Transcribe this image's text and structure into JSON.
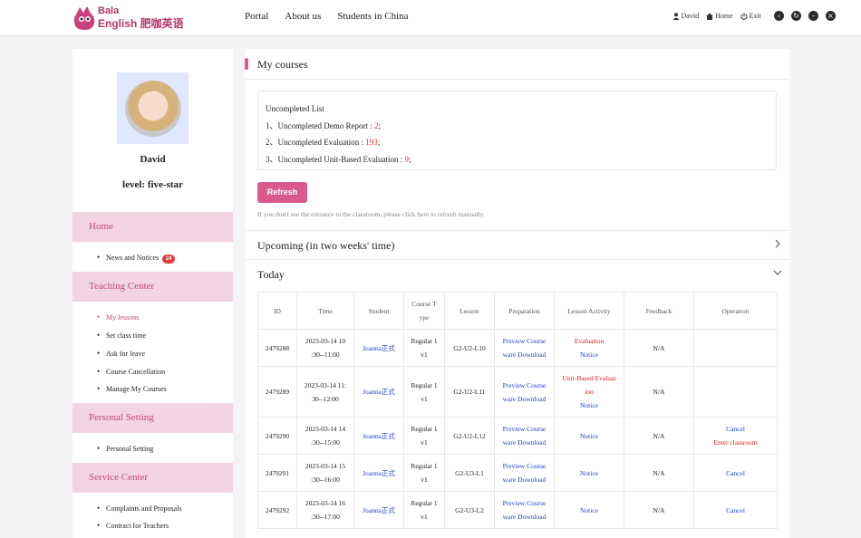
{
  "header": {
    "logo_line1": "Bala",
    "logo_line2": "English 肥咖英语",
    "nav": [
      "Portal",
      "About us",
      "Students in China"
    ],
    "user_name": "David",
    "home_label": "Home",
    "exit_label": "Exit"
  },
  "sidebar": {
    "username": "David",
    "level": "level: five-star",
    "sections": [
      {
        "label": "Home",
        "items": [
          {
            "label": "News and Notices",
            "badge": "24"
          }
        ]
      },
      {
        "label": "Teaching Center",
        "items": [
          {
            "label": "My lessons",
            "active": true
          },
          {
            "label": "Set class time"
          },
          {
            "label": "Ask for leave"
          },
          {
            "label": "Course Cancellation"
          },
          {
            "label": "Manage My Courses"
          }
        ]
      },
      {
        "label": "Personal Setting",
        "items": [
          {
            "label": "Personal Setting"
          }
        ]
      },
      {
        "label": "Service Center",
        "items": [
          {
            "label": "Complaints and Proposals"
          },
          {
            "label": "Contract for Teachers"
          }
        ]
      }
    ]
  },
  "main": {
    "title": "My courses",
    "uncompleted": {
      "heading": "Uncompleted List",
      "items": [
        {
          "prefix": "1、Uncompleted Demo Report :",
          "count": "2",
          "suffix": ";"
        },
        {
          "prefix": "2、Uncompleted Evaluation :",
          "count": "193",
          "suffix": ";"
        },
        {
          "prefix": "3、Uncompleted Unit-Based Evaluation :",
          "count": "9",
          "suffix": ";"
        }
      ]
    },
    "refresh_label": "Refresh",
    "hint": "If you don't see the entrance to the classroom, please click here to refresh manually.",
    "upcoming_label": "Upcoming (in two weeks' time)",
    "today_label": "Today",
    "table": {
      "headers": [
        "ID",
        "Time",
        "Student",
        "Course T ype",
        "Lesson",
        "Preparation",
        "Lesson Activity",
        "Feedback",
        "Operation"
      ],
      "rows": [
        {
          "id": "2479288",
          "time": "2023-03-14 10 :30--11:00",
          "student": "Joanna正式",
          "type": "Regular 1 v1",
          "lesson": "G2-U2-L10",
          "prep": "Preview Course ware Download",
          "activity": [
            {
              "t": "Evaluation",
              "c": "red"
            },
            {
              "t": "Notice",
              "c": "blue"
            }
          ],
          "feedback": "N/A",
          "operation": []
        },
        {
          "id": "2479289",
          "time": "2023-03-14 11: 30--12:00",
          "student": "Joanna正式",
          "type": "Regular 1 v1",
          "lesson": "G2-U2-L11",
          "prep": "Preview Course ware Download",
          "activity": [
            {
              "t": "Unit-Based Evaluat ion",
              "c": "red"
            },
            {
              "t": "Notice",
              "c": "blue"
            }
          ],
          "feedback": "N/A",
          "operation": []
        },
        {
          "id": "2479290",
          "time": "2023-03-14 14 :30--15:00",
          "student": "Joanna正式",
          "type": "Regular 1 v1",
          "lesson": "G2-U2-L12",
          "prep": "Preview Course ware Download",
          "activity": [
            {
              "t": "Notice",
              "c": "blue"
            }
          ],
          "feedback": "N/A",
          "operation": [
            {
              "t": "Cancel",
              "c": "blue"
            },
            {
              "t": "Enter classroom",
              "c": "red"
            }
          ]
        },
        {
          "id": "2479291",
          "time": "2023-03-14 15 :30--16:00",
          "student": "Joanna正式",
          "type": "Regular 1 v1",
          "lesson": "G2-U3-L1",
          "prep": "Preview Course ware Download",
          "activity": [
            {
              "t": "Notice",
              "c": "blue"
            }
          ],
          "feedback": "N/A",
          "operation": [
            {
              "t": "Cancel",
              "c": "blue"
            }
          ]
        },
        {
          "id": "2479292",
          "time": "2023-03-14 16 :30--17:00",
          "student": "Joanna正式",
          "type": "Regular 1 v1",
          "lesson": "G2-U3-L2",
          "prep": "Preview Course ware Download",
          "activity": [
            {
              "t": "Notice",
              "c": "blue"
            }
          ],
          "feedback": "N/A",
          "operation": [
            {
              "t": "Cancel",
              "c": "blue"
            }
          ]
        }
      ]
    }
  }
}
